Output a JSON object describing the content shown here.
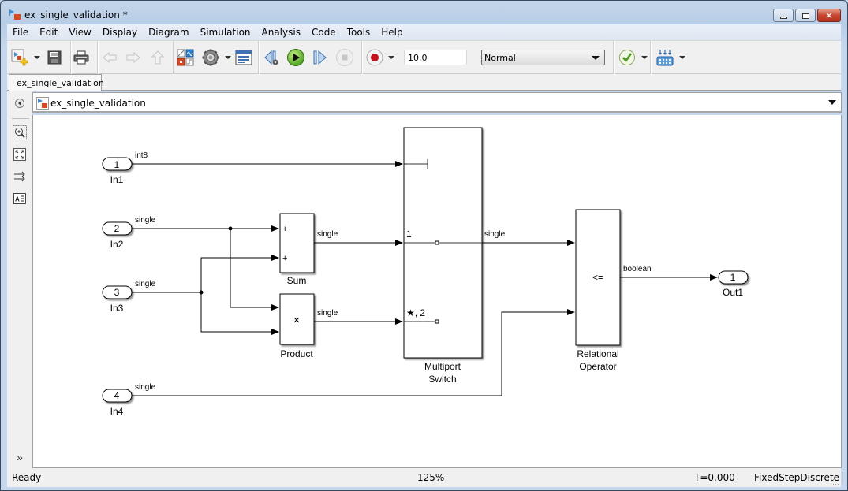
{
  "window": {
    "title": "ex_single_validation *",
    "controls": {
      "minimize": "minimize",
      "maximize": "maximize",
      "close": "close"
    }
  },
  "menu": [
    "File",
    "Edit",
    "View",
    "Display",
    "Diagram",
    "Simulation",
    "Analysis",
    "Code",
    "Tools",
    "Help"
  ],
  "toolbar": {
    "icons": [
      "new-model-icon",
      "save-icon",
      "print-icon",
      "back-icon",
      "forward-icon",
      "up-icon",
      "library-browser-icon",
      "model-config-icon",
      "model-explorer-icon",
      "step-back-icon",
      "run-icon",
      "step-forward-icon",
      "stop-icon",
      "record-icon",
      "model-advisor-icon",
      "build-icon"
    ],
    "stop_time": "10.0",
    "sim_mode": "Normal"
  },
  "tabs": [
    {
      "label": "ex_single_validation",
      "active": true
    }
  ],
  "address": {
    "path": "ex_single_validation"
  },
  "left_panel": [
    "back-nav-icon",
    "zoom-area-icon",
    "fit-to-view-icon",
    "signal-routing-icon",
    "annotation-icon",
    "expand-panel-icon"
  ],
  "diagram": {
    "inports": [
      {
        "number": "1",
        "name": "In1",
        "signal_type": "int8"
      },
      {
        "number": "2",
        "name": "In2",
        "signal_type": "single"
      },
      {
        "number": "3",
        "name": "In3",
        "signal_type": "single"
      },
      {
        "number": "4",
        "name": "In4",
        "signal_type": "single"
      }
    ],
    "sum": {
      "name": "Sum",
      "ports": [
        "+",
        "+"
      ],
      "output_type": "single"
    },
    "product": {
      "name": "Product",
      "symbol": "×",
      "output_type": "single"
    },
    "switch": {
      "name_line1": "Multiport",
      "name_line2": "Switch",
      "port1_label": "1",
      "port2_label": "★, 2",
      "output_type": "single"
    },
    "relop": {
      "name_line1": "Relational",
      "name_line2": "Operator",
      "operator": "<=",
      "output_type": "boolean"
    },
    "outport": {
      "number": "1",
      "name": "Out1"
    }
  },
  "status": {
    "state": "Ready",
    "zoom": "125%",
    "time": "T=0.000",
    "solver": "FixedStepDiscrete"
  }
}
